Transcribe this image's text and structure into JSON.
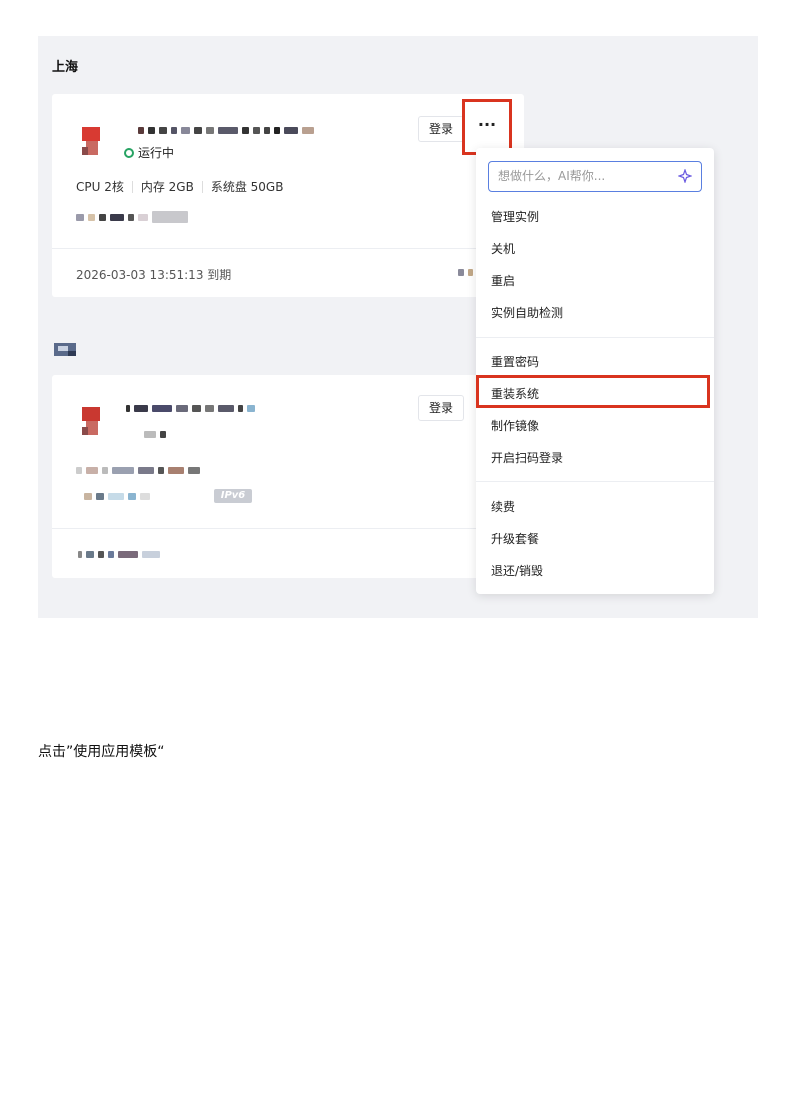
{
  "region1": {
    "title": "上海"
  },
  "card1": {
    "status": "运行中",
    "specs": [
      "CPU 2核",
      "内存 2GB",
      "系统盘 50GB"
    ],
    "expire": "2026-03-03 13:51:13 到期",
    "login_label": "登录",
    "more_label": "···"
  },
  "card2": {
    "login_label": "登录",
    "ipv6_badge": "IPv6"
  },
  "menu": {
    "search_placeholder": "想做什么，AI帮你...",
    "items": [
      "管理实例",
      "关机",
      "重启",
      "实例自助检测",
      "重置密码",
      "重装系统",
      "制作镜像",
      "开启扫码登录",
      "续费",
      "升级套餐",
      "退还/销毁"
    ]
  },
  "caption": "点击”使用应用模板“",
  "colors": {
    "highlight": "#d9341f",
    "running": "#27a363",
    "panel_bg": "#f1f2f5"
  }
}
